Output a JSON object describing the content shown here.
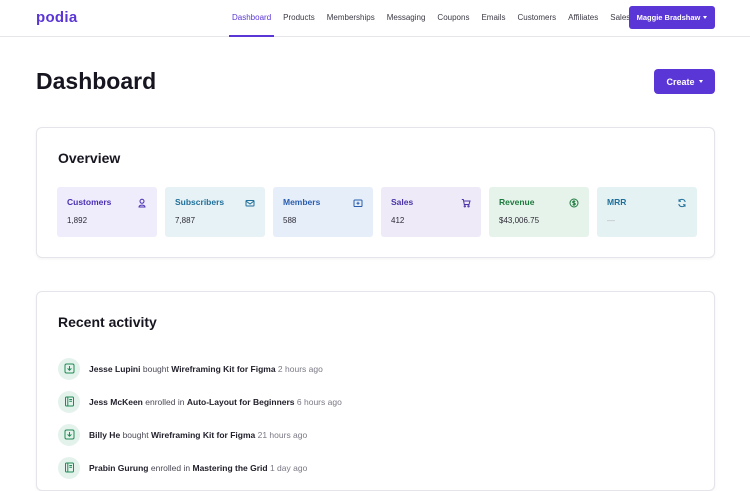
{
  "app": {
    "logo": "podia"
  },
  "nav": {
    "items": [
      {
        "label": "Dashboard",
        "active": true
      },
      {
        "label": "Products"
      },
      {
        "label": "Memberships"
      },
      {
        "label": "Messaging"
      },
      {
        "label": "Coupons"
      },
      {
        "label": "Emails"
      },
      {
        "label": "Customers"
      },
      {
        "label": "Affiliates"
      },
      {
        "label": "Sales"
      }
    ],
    "user_button": "Maggie Bradshaw"
  },
  "header": {
    "title": "Dashboard",
    "create_label": "Create"
  },
  "overview": {
    "title": "Overview",
    "stats": [
      {
        "label": "Customers",
        "value": "1,892",
        "icon": "user-icon",
        "color": "#4a2fb3"
      },
      {
        "label": "Subscribers",
        "value": "7,887",
        "icon": "mail-icon",
        "color": "#1f6f9a"
      },
      {
        "label": "Members",
        "value": "588",
        "icon": "member-card-icon",
        "color": "#2a5dae"
      },
      {
        "label": "Sales",
        "value": "412",
        "icon": "cart-icon",
        "color": "#4a33a8"
      },
      {
        "label": "Revenue",
        "value": "$43,006.75",
        "icon": "dollar-coin-icon",
        "color": "#1d7a3e"
      },
      {
        "label": "MRR",
        "value": "—",
        "icon": "refresh-icon",
        "color": "#1f6f9a"
      }
    ]
  },
  "activity": {
    "title": "Recent activity",
    "items": [
      {
        "name": "Jesse Lupini",
        "action": "bought",
        "item": "Wireframing Kit for Figma",
        "time": "2 hours ago",
        "icon": "download-icon"
      },
      {
        "name": "Jess McKeen",
        "action": "enrolled in",
        "item": "Auto-Layout for Beginners",
        "time": "6 hours ago",
        "icon": "course-book-icon"
      },
      {
        "name": "Billy He",
        "action": "bought",
        "item": "Wireframing Kit for Figma",
        "time": "21 hours ago",
        "icon": "download-icon"
      },
      {
        "name": "Prabin Gurung",
        "action": "enrolled in",
        "item": "Mastering the Grid",
        "time": "1 day ago",
        "icon": "course-book-icon"
      }
    ]
  },
  "colors": {
    "brand": "#5b36d6",
    "activity_icon_bg": "#e4f2ec",
    "activity_icon": "#1f8a55"
  }
}
